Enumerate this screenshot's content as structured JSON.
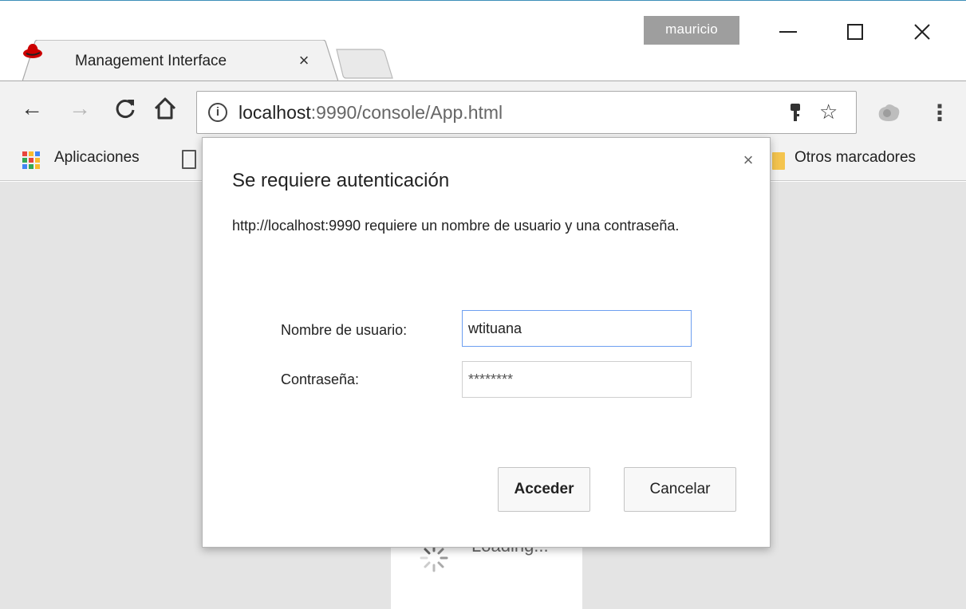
{
  "window": {
    "profile_name": "mauricio",
    "minimize": "minimize",
    "maximize": "maximize",
    "close": "×"
  },
  "tab": {
    "title": "Management Interface",
    "close": "×"
  },
  "toolbar": {
    "back": "←",
    "forward": "→",
    "reload": "C",
    "home": "⌂",
    "url_host": "localhost",
    "url_rest": ":9990/console/App.html",
    "key_icon": "key-icon",
    "star": "☆",
    "menu": "⋮"
  },
  "bookmarks": {
    "apps_label": "Aplicaciones",
    "others_label": "Otros marcadores",
    "apps_colors": [
      "#e8453c",
      "#f9bb2d",
      "#4285f4",
      "#34a853",
      "#e8453c",
      "#f9bb2d",
      "#4285f4",
      "#34a853",
      "#f9bb2d"
    ]
  },
  "page": {
    "loading_text": "Loading..."
  },
  "dialog": {
    "title": "Se requiere autenticación",
    "message": "http://localhost:9990 requiere un nombre de usuario y una contraseña.",
    "close": "×",
    "username_label": "Nombre de usuario:",
    "username_value": "wtituana",
    "password_label": "Contraseña:",
    "password_value": "********",
    "login_button": "Acceder",
    "cancel_button": "Cancelar"
  }
}
